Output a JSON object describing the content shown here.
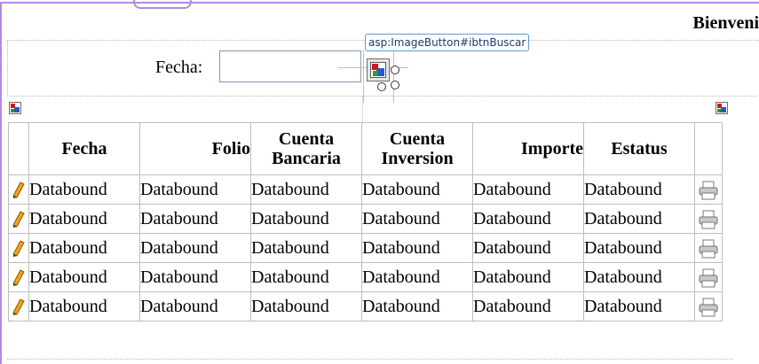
{
  "header": {
    "welcome_text": "Bienveni"
  },
  "filter": {
    "fecha_label": "Fecha:",
    "fecha_value": "",
    "tooltip": "asp:ImageButton#ibtnBuscar"
  },
  "grid": {
    "columns": [
      "Fecha",
      "Folio",
      "Cuenta Bancaria",
      "Cuenta Inversion",
      "Importe",
      "Estatus"
    ],
    "rows": [
      [
        "Databound",
        "Databound",
        "Databound",
        "Databound",
        "Databound",
        "Databound"
      ],
      [
        "Databound",
        "Databound",
        "Databound",
        "Databound",
        "Databound",
        "Databound"
      ],
      [
        "Databound",
        "Databound",
        "Databound",
        "Databound",
        "Databound",
        "Databound"
      ],
      [
        "Databound",
        "Databound",
        "Databound",
        "Databound",
        "Databound",
        "Databound"
      ],
      [
        "Databound",
        "Databound",
        "Databound",
        "Databound",
        "Databound",
        "Databound"
      ]
    ]
  },
  "icons": {
    "edit": "pencil-icon",
    "print": "printer-icon",
    "placeholder": "broken-image-icon"
  },
  "colors": {
    "frame": "#b48ae0",
    "tooltip_border": "#5b9bd5",
    "pencil": "#f2a21b"
  }
}
